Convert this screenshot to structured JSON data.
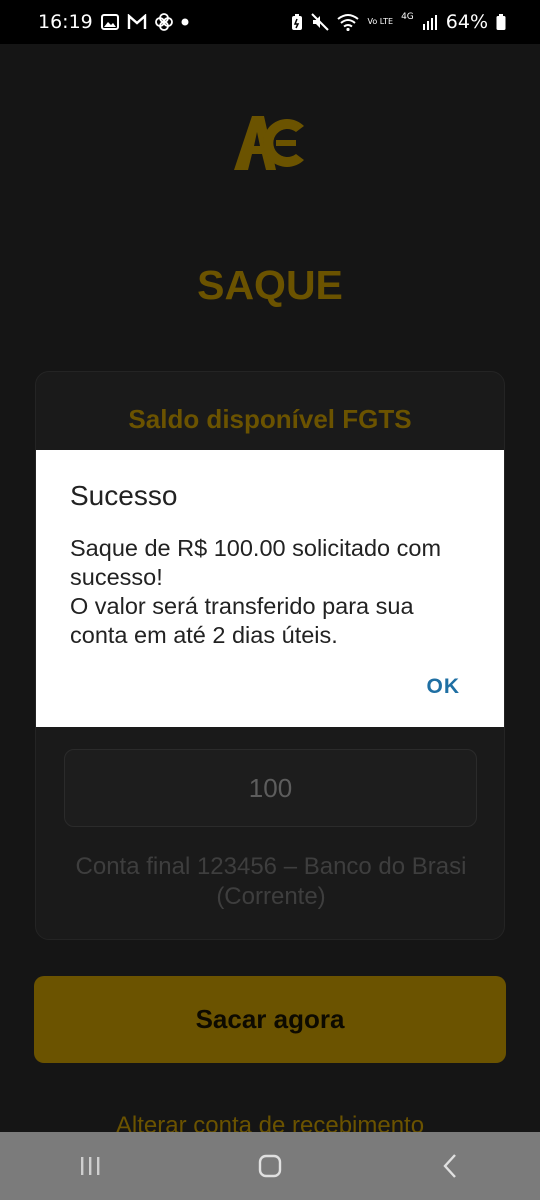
{
  "status_bar": {
    "time": "16:19",
    "network": "4G",
    "volte": "Vo LTE",
    "battery": "64%"
  },
  "app": {
    "logo_name": "AC logo",
    "title": "SAQUE",
    "card": {
      "title": "Saldo disponível FGTS",
      "amount_value": "100",
      "account_line1": "Conta final 123456 – Banco do Brasi",
      "account_line2": "(Corrente)"
    },
    "withdraw_button": "Sacar agora",
    "change_account_link": "Alterar conta de recebimento"
  },
  "dialog": {
    "title": "Sucesso",
    "message": "Saque de R$ 100.00 solicitado com sucesso!\nO valor será transferido para sua conta em até 2 dias úteis.",
    "ok_label": "OK"
  },
  "colors": {
    "accent": "#6b5300",
    "background": "#151515",
    "dialog_button": "#1f6fa3"
  },
  "nav_icons": [
    "recent-apps-icon",
    "home-icon",
    "back-icon"
  ]
}
